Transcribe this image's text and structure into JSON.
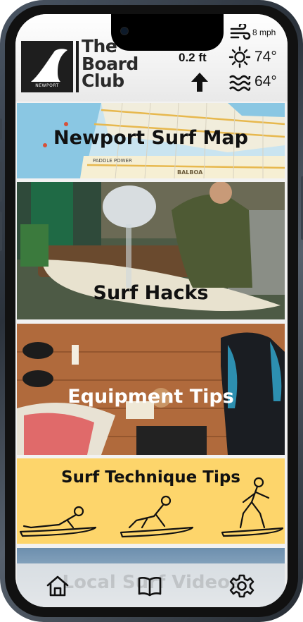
{
  "brand": {
    "logo_badge": "NEWPORT",
    "name_line1": "The",
    "name_line2": "Board",
    "name_line3": "Club"
  },
  "conditions": {
    "tide_value": "0.2 ft",
    "tide_icon": "tide-icon",
    "tide_direction_icon": "arrow-up-icon",
    "wind_value": "8 mph",
    "wind_icon": "wind-icon",
    "air_temp_value": "74°",
    "air_temp_icon": "sun-icon",
    "water_temp_value": "64°",
    "water_temp_icon": "waves-icon"
  },
  "map_labels": {
    "street_1": "BALBOA",
    "street_2": "PADDLE POWER"
  },
  "cards": [
    {
      "label": "Newport Surf Map"
    },
    {
      "label": "Surf Hacks"
    },
    {
      "label": "Equipment Tips"
    },
    {
      "label": "Surf Technique Tips"
    },
    {
      "label": "Local Surf Videos"
    }
  ],
  "nav": {
    "home_icon": "home-icon",
    "guide_icon": "book-icon",
    "settings_icon": "gear-icon"
  },
  "colors": {
    "technique_bg": "#fdd56b",
    "header_text": "#2a2a2a"
  }
}
